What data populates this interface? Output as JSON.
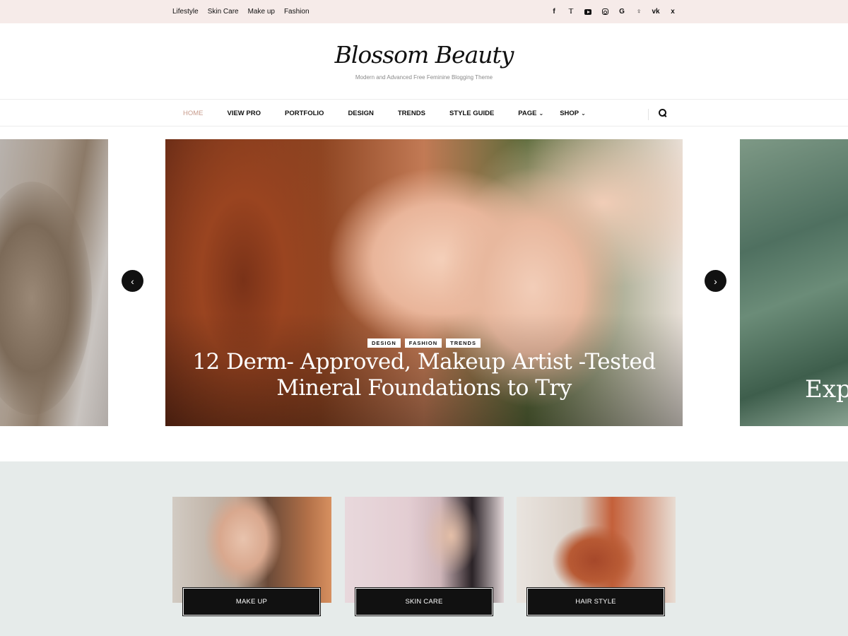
{
  "topbar": {
    "links": [
      "Lifestyle",
      "Skin Care",
      "Make up",
      "Fashion"
    ],
    "social": [
      "facebook-icon",
      "twitter-icon",
      "youtube-icon",
      "instagram-icon",
      "google-plus-icon",
      "odnoklassniki-icon",
      "vk-icon",
      "xing-icon"
    ]
  },
  "header": {
    "logo": "Blossom Beauty",
    "tagline": "Modern and Advanced Free Feminine Blogging Theme"
  },
  "nav": {
    "items": [
      {
        "label": "HOME",
        "active": true
      },
      {
        "label": "VIEW PRO"
      },
      {
        "label": "PORTFOLIO"
      },
      {
        "label": "DESIGN"
      },
      {
        "label": "TRENDS"
      },
      {
        "label": "STYLE GUIDE"
      },
      {
        "label": "PAGE",
        "dropdown": true
      },
      {
        "label": "SHOP",
        "dropdown": true
      }
    ],
    "accent_color": "#c89c8d"
  },
  "slider": {
    "tags": [
      "DESIGN",
      "FASHION",
      "TRENDS"
    ],
    "title_line1": "12 Derm- Approved, Makeup Artist -Tested",
    "title_line2": "Mineral Foundations to Try",
    "next_slide_peek": "Expe"
  },
  "categories": [
    {
      "label": "MAKE UP"
    },
    {
      "label": "SKIN CARE"
    },
    {
      "label": "HAIR STYLE"
    }
  ],
  "colors": {
    "topbar_bg": "#f6ebe9",
    "categories_bg": "#e6ebea"
  }
}
